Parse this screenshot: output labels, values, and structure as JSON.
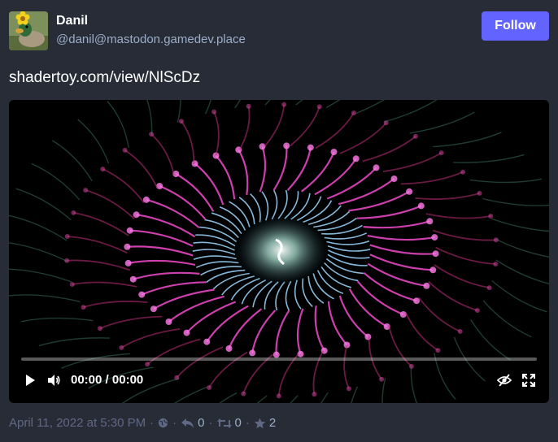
{
  "account": {
    "display_name": "Danil",
    "handle": "@danil@mastodon.gamedev.place",
    "avatar_icon": "duck-with-flower-avatar"
  },
  "follow_button": {
    "label": "Follow",
    "color": "#6364ff"
  },
  "status": {
    "text": "shadertoy.com/view/NlScDz"
  },
  "video": {
    "current_time": "00:00",
    "separator": "/",
    "duration": "00:00",
    "progress_fraction": 0,
    "icons": [
      "play-icon",
      "volume-icon",
      "hide-media-icon",
      "fullscreen-icon"
    ]
  },
  "meta": {
    "timestamp": "April 11, 2022 at 5:30 PM",
    "separator": "·",
    "visibility_icon": "globe-icon",
    "replies": "0",
    "boosts": "0",
    "favourites": "2"
  },
  "colors": {
    "background": "#282c37",
    "secondary_text": "#9baec8",
    "meta_text": "#606984"
  }
}
